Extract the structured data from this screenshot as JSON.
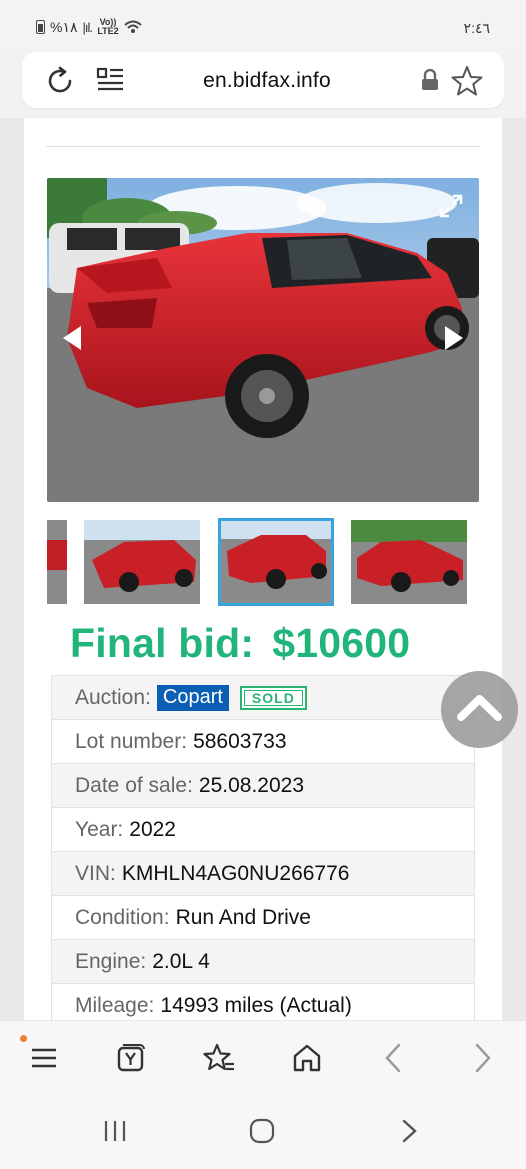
{
  "status_bar": {
    "battery_percent": "%١٨",
    "network": "Vo)) LTE2",
    "time": "٢:٤٦"
  },
  "browser": {
    "url": "en.bidfax.info",
    "icons": [
      "reload-icon",
      "reader-mode-icon",
      "lock-icon",
      "bookmark-star-icon"
    ]
  },
  "listing": {
    "final_bid_label": "Final bid:",
    "final_bid_value": "$10600",
    "details": {
      "auction_label": "Auction:",
      "auction_value": "Copart",
      "sold_badge": "SOLD",
      "lot_label": "Lot number:",
      "lot_value": "58603733",
      "date_label": "Date of sale:",
      "date_value": "25.08.2023",
      "year_label": "Year:",
      "year_value": "2022",
      "vin_label": "VIN:",
      "vin_value": "KMHLN4AG0NU266776",
      "condition_label": "Condition:",
      "condition_value": "Run And Drive",
      "engine_label": "Engine:",
      "engine_value": "2.0L 4",
      "mileage_label": "Mileage:",
      "mileage_value": "14993 miles (Actual)"
    }
  },
  "colors": {
    "final_bid": "#21b47b",
    "auction_badge": "#0a5fb4",
    "sold_badge": "#29b471",
    "active_thumb_border": "#39a3db",
    "car_red": "#d3202a"
  },
  "toolbar": {
    "icons": [
      "menu-icon",
      "yandex-tabs-icon",
      "favorites-icon",
      "home-icon",
      "back-icon",
      "forward-icon"
    ]
  },
  "navbar": {
    "icons": [
      "recent-apps-icon",
      "home-circle-icon",
      "nav-back-icon"
    ]
  }
}
